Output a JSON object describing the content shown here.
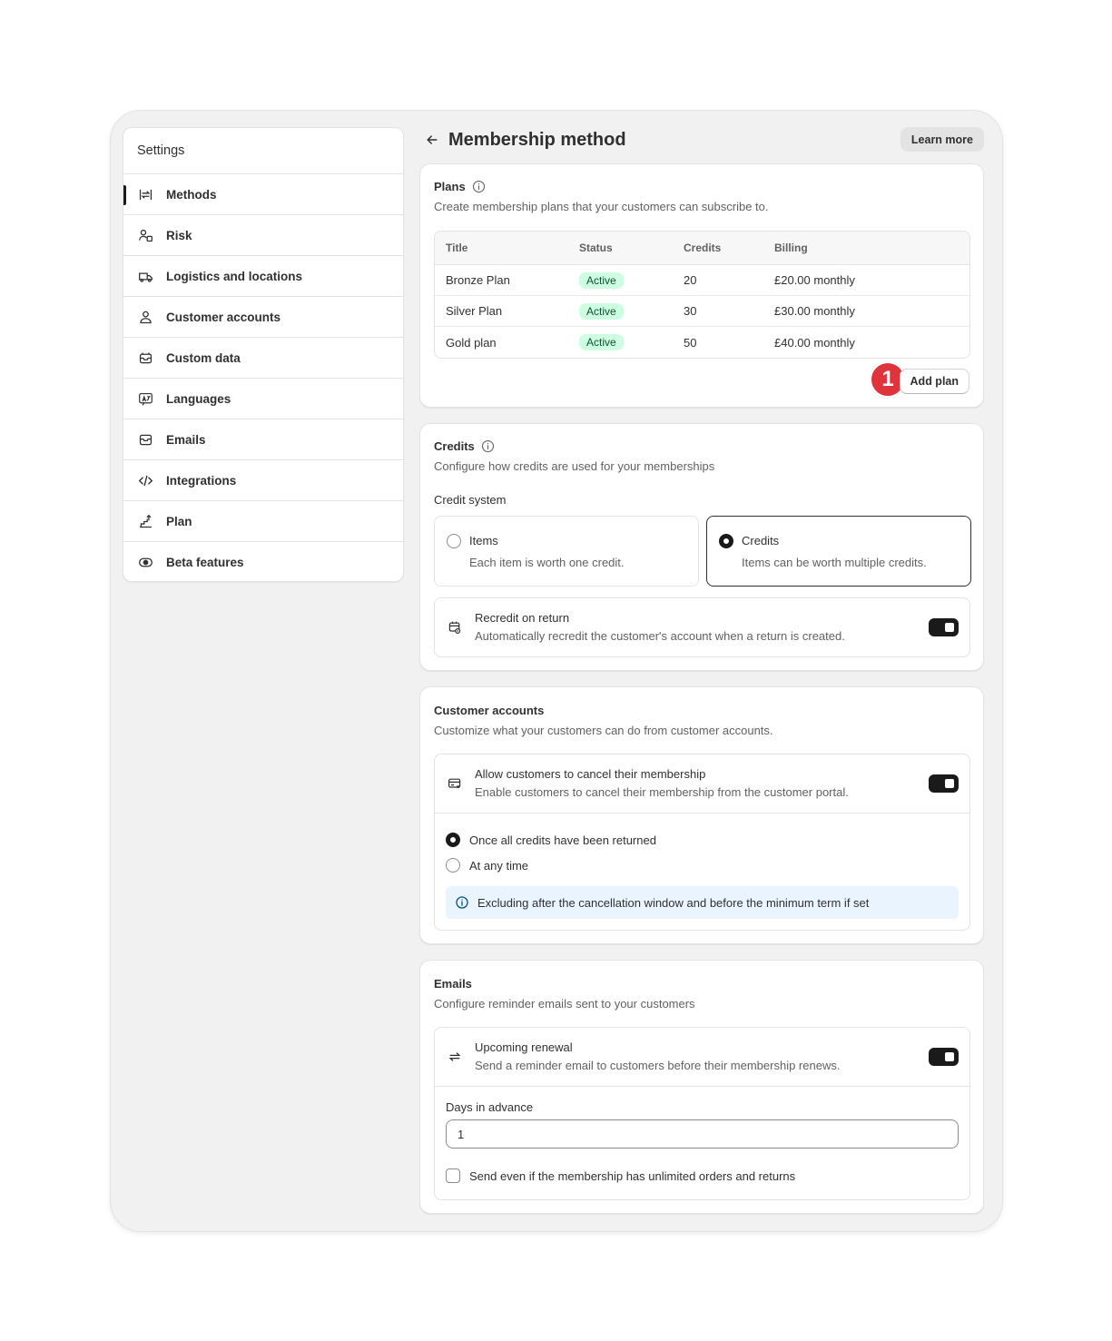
{
  "settings": {
    "title": "Settings",
    "nav": [
      {
        "label": "Methods",
        "icon": "methods-icon",
        "active": true
      },
      {
        "label": "Risk",
        "icon": "risk-icon"
      },
      {
        "label": "Logistics and locations",
        "icon": "truck-icon"
      },
      {
        "label": "Customer accounts",
        "icon": "person-icon"
      },
      {
        "label": "Custom data",
        "icon": "inbox-icon"
      },
      {
        "label": "Languages",
        "icon": "language-icon"
      },
      {
        "label": "Emails",
        "icon": "email-icon"
      },
      {
        "label": "Integrations",
        "icon": "code-icon"
      },
      {
        "label": "Plan",
        "icon": "plan-icon"
      },
      {
        "label": "Beta features",
        "icon": "eye-toggle-icon"
      }
    ]
  },
  "header": {
    "title": "Membership method",
    "learn_more": "Learn more"
  },
  "plans": {
    "title": "Plans",
    "subtitle": "Create membership plans that your customers can subscribe to.",
    "columns": [
      "Title",
      "Status",
      "Credits",
      "Billing"
    ],
    "rows": [
      {
        "title": "Bronze Plan",
        "status": "Active",
        "credits": "20",
        "billing": "£20.00 monthly"
      },
      {
        "title": "Silver Plan",
        "status": "Active",
        "credits": "30",
        "billing": "£30.00 monthly"
      },
      {
        "title": "Gold plan",
        "status": "Active",
        "credits": "50",
        "billing": "£40.00 monthly"
      }
    ],
    "add_button": "Add plan",
    "step_marker": "1"
  },
  "credits": {
    "title": "Credits",
    "subtitle": "Configure how credits are used for your memberships",
    "system_label": "Credit system",
    "options": [
      {
        "label": "Items",
        "desc": "Each item is worth one credit.",
        "selected": false
      },
      {
        "label": "Credits",
        "desc": "Items can be worth multiple credits.",
        "selected": true
      }
    ],
    "recredit": {
      "title": "Recredit on return",
      "desc": "Automatically recredit the customer's account when a return is created.",
      "enabled": true
    }
  },
  "customer_accounts": {
    "title": "Customer accounts",
    "subtitle": "Customize what your customers can do from customer accounts.",
    "cancel": {
      "title": "Allow customers to cancel their membership",
      "desc": "Enable customers to cancel their membership from the customer portal.",
      "enabled": true
    },
    "options": [
      {
        "label": "Once all credits have been returned",
        "selected": true
      },
      {
        "label": "At any time",
        "selected": false
      }
    ],
    "notice": "Excluding after the cancellation window and before the minimum term if set"
  },
  "emails": {
    "title": "Emails",
    "subtitle": "Configure reminder emails sent to your customers",
    "renewal": {
      "title": "Upcoming renewal",
      "desc": "Send a reminder email to customers before their membership renews.",
      "enabled": true
    },
    "days_label": "Days in advance",
    "days_value": "1",
    "unlimited_checkbox": "Send even if the membership has unlimited orders and returns"
  },
  "colors": {
    "active_badge_bg": "#cdfee1",
    "active_badge_text": "#0c5132",
    "step_marker": "#e0343d",
    "notice_bg": "#eaf4ff"
  }
}
